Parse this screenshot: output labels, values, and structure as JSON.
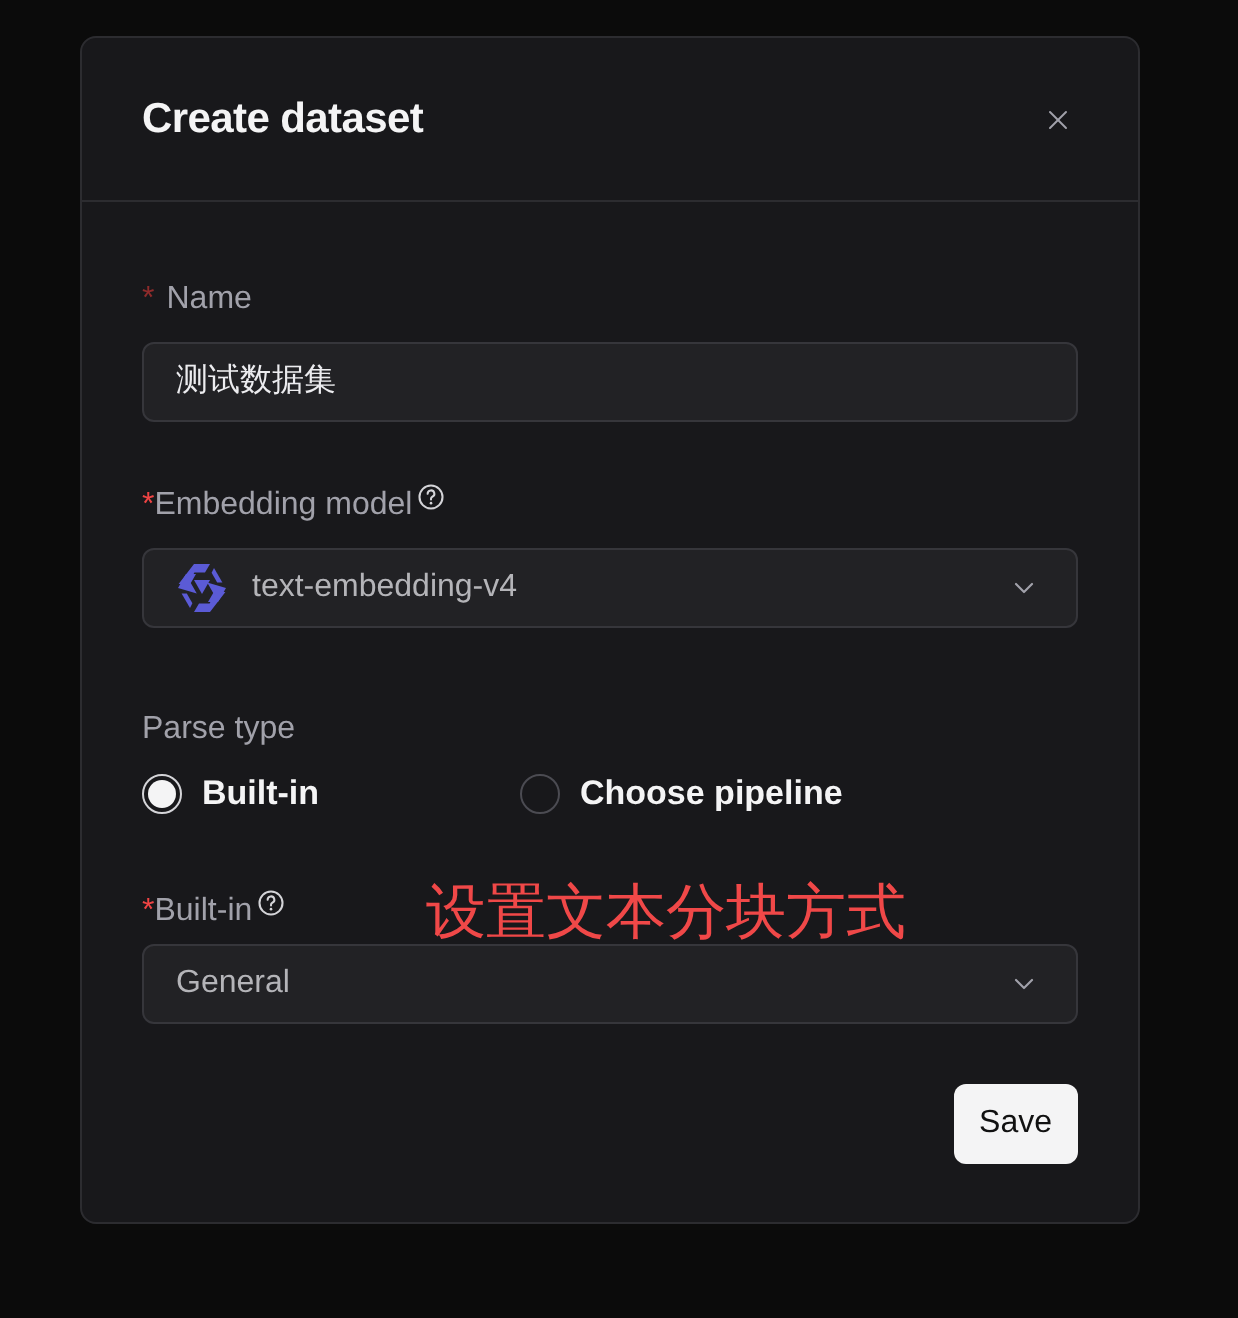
{
  "dialog": {
    "title": "Create dataset"
  },
  "fields": [
    {
      "kind": "input",
      "label": "Name",
      "required_mark": "*",
      "help": false,
      "value": "测试数据集"
    },
    {
      "kind": "model_select",
      "label": "Embedding model",
      "required_mark": "*",
      "help": true,
      "value": "text-embedding-v4"
    },
    {
      "kind": "radio",
      "label": "Parse type",
      "help": false,
      "options": [
        {
          "label": "Built-in",
          "selected": true
        },
        {
          "label": "Choose pipeline",
          "selected": false
        }
      ]
    },
    {
      "kind": "select",
      "label": "Built-in",
      "required_mark": "*",
      "help": true,
      "value": "General",
      "annotation": "设置文本分块方式"
    }
  ],
  "save_button": {
    "label": "Save"
  }
}
